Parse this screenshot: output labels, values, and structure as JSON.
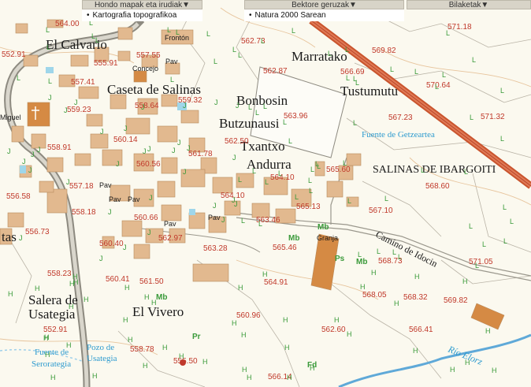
{
  "header": {
    "menus": [
      {
        "label": "Hondo mapak eta irudiak",
        "arrow": "▼"
      },
      {
        "label": "Bektore geruzak",
        "arrow": "▼"
      },
      {
        "label": "Bilaketak",
        "arrow": "▼"
      }
    ],
    "active_layers": [
      {
        "label": "Kartografia topografikoa"
      },
      {
        "label": "Natura 2000 Sarean"
      }
    ]
  },
  "map": {
    "colors": {
      "background": "#fbf9ef",
      "building": "#e2b98f",
      "building_stroke": "#b88a5c",
      "highlight_building": "#d58a44",
      "road": "#8d8a80",
      "main_road": "#c9542e",
      "river": "#5fa9d8",
      "elevation_text": "#c0392b",
      "green_text": "#3a9a3a",
      "blue_text": "#2e9bcf"
    },
    "place_labels": [
      {
        "text": "El Calvario"
      },
      {
        "text": "Caseta de Salinas"
      },
      {
        "text": "Marratako"
      },
      {
        "text": "Tustumutu"
      },
      {
        "text": "Bonbosin"
      },
      {
        "text": "Butzunausi"
      },
      {
        "text": "Txantxo"
      },
      {
        "text": "Andurra"
      },
      {
        "text": "SALINAS DE IBARGOITI"
      },
      {
        "text": "tas"
      },
      {
        "text": "Salera de"
      },
      {
        "text": "Usategia"
      },
      {
        "text": "El Vivero"
      },
      {
        "text": "Camino de Idocin"
      }
    ],
    "small_labels": [
      {
        "text": "Frontón"
      },
      {
        "text": "Pav"
      },
      {
        "text": "Concejo"
      },
      {
        "text": "Miguel"
      },
      {
        "text": "Pav"
      },
      {
        "text": "Pav"
      },
      {
        "text": "Pav"
      },
      {
        "text": "Pav"
      },
      {
        "text": "Pav"
      },
      {
        "text": "Granja"
      }
    ],
    "blue_labels": [
      {
        "text": "Fuente de Getzeartea"
      },
      {
        "text": "Fuente de"
      },
      {
        "text": "Serorategia"
      },
      {
        "text": "Pozo de"
      },
      {
        "text": "Usategia"
      },
      {
        "text": "Río Elorz"
      }
    ],
    "elevations": [
      {
        "text": "564.00"
      },
      {
        "text": "562.73"
      },
      {
        "text": "552.91"
      },
      {
        "text": "557.55"
      },
      {
        "text": "555.91"
      },
      {
        "text": "557.41"
      },
      {
        "text": "559.32"
      },
      {
        "text": "558.64"
      },
      {
        "text": "559.23"
      },
      {
        "text": "560.14"
      },
      {
        "text": "558.91"
      },
      {
        "text": "560.56"
      },
      {
        "text": "561.78"
      },
      {
        "text": "562.50"
      },
      {
        "text": "563.96"
      },
      {
        "text": "562.87"
      },
      {
        "text": "569.82"
      },
      {
        "text": "566.69"
      },
      {
        "text": "571.18"
      },
      {
        "text": "570.64"
      },
      {
        "text": "567.23"
      },
      {
        "text": "571.32"
      },
      {
        "text": "565.60"
      },
      {
        "text": "564.10"
      },
      {
        "text": "568.60"
      },
      {
        "text": "556.58"
      },
      {
        "text": "557.18"
      },
      {
        "text": "558.18"
      },
      {
        "text": "564.10"
      },
      {
        "text": "560.66"
      },
      {
        "text": "562.97"
      },
      {
        "text": "563.28"
      },
      {
        "text": "563.46"
      },
      {
        "text": "565.13"
      },
      {
        "text": "567.10"
      },
      {
        "text": "565.46"
      },
      {
        "text": "568.73"
      },
      {
        "text": "571.05"
      },
      {
        "text": "556.73"
      },
      {
        "text": "560.40"
      },
      {
        "text": "558.23"
      },
      {
        "text": "560.41"
      },
      {
        "text": "561.50"
      },
      {
        "text": "564.91"
      },
      {
        "text": "568.05"
      },
      {
        "text": "568.32"
      },
      {
        "text": "569.82"
      },
      {
        "text": "560.96"
      },
      {
        "text": "552.91"
      },
      {
        "text": "558.78"
      },
      {
        "text": "562.60"
      },
      {
        "text": "566.41"
      },
      {
        "text": "555.50"
      },
      {
        "text": "566.14"
      }
    ],
    "vegetation_codes": [
      {
        "text": "Mb"
      },
      {
        "text": "Mb"
      },
      {
        "text": "Ps"
      },
      {
        "text": "Mb"
      },
      {
        "text": "Pr"
      },
      {
        "text": "Fd"
      }
    ]
  }
}
